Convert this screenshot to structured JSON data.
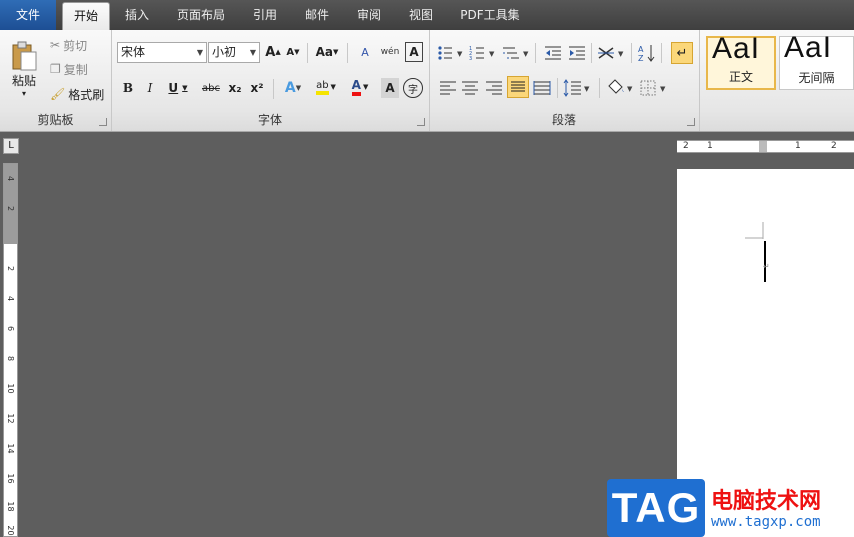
{
  "tabs": [
    "文件",
    "开始",
    "插入",
    "页面布局",
    "引用",
    "邮件",
    "审阅",
    "视图",
    "PDF工具集"
  ],
  "clipboard": {
    "paste": "粘贴",
    "cut": "剪切",
    "copy": "复制",
    "format_painter": "格式刷",
    "label": "剪贴板"
  },
  "font": {
    "name": "宋体",
    "size": "小初",
    "label": "字体",
    "grow": "A",
    "shrink": "A",
    "change_case": "Aa",
    "clear": "A",
    "phonetic": "wén",
    "border": "A",
    "bold": "B",
    "italic": "I",
    "underline": "U",
    "strike": "abc",
    "sub": "x₂",
    "sup": "x²",
    "effect": "A",
    "highlight": "ab",
    "color": "A",
    "shade": "A",
    "enclose": "字"
  },
  "paragraph": {
    "label": "段落"
  },
  "styles": [
    {
      "preview": "AaI",
      "name": "正文"
    },
    {
      "preview": "AaI",
      "name": "无间隔"
    }
  ],
  "ruler": {
    "corner": "L",
    "h_marks": [
      "2",
      "1",
      "1",
      "2"
    ],
    "v_marks": [
      "4",
      "2",
      "2",
      "4",
      "6",
      "8",
      "10",
      "12",
      "14",
      "16",
      "18",
      "20"
    ]
  },
  "watermark": {
    "logo": "TAG",
    "title": "电脑技术网",
    "url": "www.tagxp.com"
  },
  "colors": {
    "accent": "#1f6fd1",
    "font_color_bar": "#e11",
    "highlight_bar": "#f5e400"
  }
}
